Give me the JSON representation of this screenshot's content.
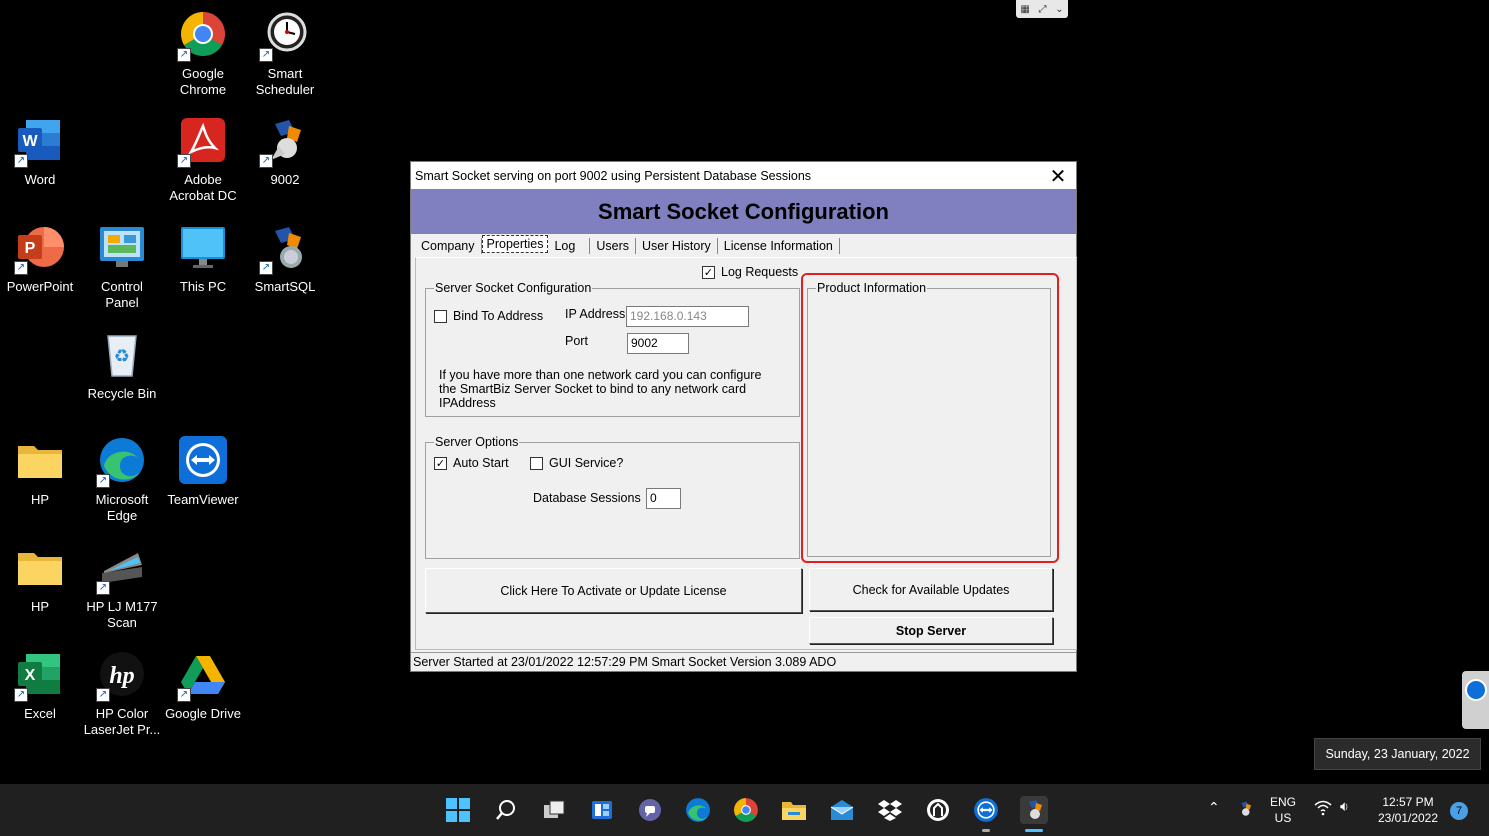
{
  "desktop": {
    "icons": [
      {
        "label": "Google\nChrome",
        "icon": "chrome-icon"
      },
      {
        "label": "Smart\nScheduler",
        "icon": "clock-icon"
      },
      {
        "label": "Word",
        "icon": "word-icon"
      },
      {
        "label": "Adobe\nAcrobat DC",
        "icon": "acrobat-icon"
      },
      {
        "label": "9002",
        "icon": "smartsocket-icon"
      },
      {
        "label": "PowerPoint",
        "icon": "powerpoint-icon"
      },
      {
        "label": "Control\nPanel",
        "icon": "control-panel-icon"
      },
      {
        "label": "This PC",
        "icon": "monitor-icon"
      },
      {
        "label": "SmartSQL",
        "icon": "smartsql-icon"
      },
      {
        "label": "Recycle Bin",
        "icon": "recycle-bin-icon"
      },
      {
        "label": "HP",
        "icon": "folder-icon"
      },
      {
        "label": "Microsoft\nEdge",
        "icon": "edge-icon"
      },
      {
        "label": "TeamViewer",
        "icon": "teamviewer-icon"
      },
      {
        "label": "HP",
        "icon": "folder-icon"
      },
      {
        "label": "HP LJ M177\nScan",
        "icon": "scanner-icon"
      },
      {
        "label": "Excel",
        "icon": "excel-icon"
      },
      {
        "label": "HP Color\nLaserJet Pr...",
        "icon": "hp-icon"
      },
      {
        "label": "Google Drive",
        "icon": "google-drive-icon"
      }
    ]
  },
  "window": {
    "title": "Smart Socket serving on  port 9002 using  Persistent Database Sessions",
    "banner": "Smart Socket Configuration",
    "tabs": [
      "Company",
      "Properties",
      "Log",
      "Users",
      "User History",
      "License Information"
    ],
    "log_requests_label": "Log Requests",
    "server_socket_group": {
      "legend": "Server Socket Configuration",
      "bind_label": "Bind To Address",
      "ip_label": "IP Address",
      "ip_value": "192.168.0.143",
      "port_label": "Port",
      "port_value": "9002",
      "help_text": "If you have more than one network card you can configure the SmartBiz Server Socket to bind to any network card IPAddress"
    },
    "server_options_group": {
      "legend": "Server Options",
      "auto_start_label": "Auto Start",
      "gui_service_label": "GUI Service?",
      "db_sessions_label": "Database Sessions",
      "db_sessions_value": "0"
    },
    "product_info_legend": "Product Information",
    "activate_button": "Click Here To Activate or Update License",
    "updates_button": "Check for Available Updates",
    "stop_button": "Stop Server",
    "status": "Server Started at 23/01/2022 12:57:29 PM Smart Socket Version 3.089 ADO"
  },
  "date_popup": "Sunday, 23 January, 2022",
  "taskbar": {
    "lang_top": "ENG",
    "lang_bottom": "US",
    "time": "12:57 PM",
    "date": "23/01/2022",
    "notifications": "7"
  },
  "colors": {
    "banner": "#8080c0",
    "highlight": "#e02020",
    "taskbar": "#202020"
  }
}
